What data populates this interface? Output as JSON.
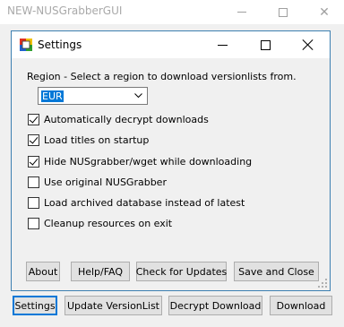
{
  "main_window": {
    "title": "NEW-NUSGrabberGUI",
    "buttons": {
      "settings": "Settings",
      "update_versionlist": "Update VersionList",
      "decrypt_download": "Decrypt Download",
      "download": "Download"
    }
  },
  "settings_dialog": {
    "title": "Settings",
    "region_label": "Region - Select a region to download versionlists from.",
    "region_selected": "EUR",
    "options": [
      {
        "label": "Automatically decrypt downloads",
        "checked": true
      },
      {
        "label": "Load titles on startup",
        "checked": true
      },
      {
        "label": "Hide NUSgrabber/wget while downloading",
        "checked": true
      },
      {
        "label": "Use original NUSGrabber",
        "checked": false
      },
      {
        "label": "Load archived database instead of latest",
        "checked": false
      },
      {
        "label": "Cleanup resources on exit",
        "checked": false
      }
    ],
    "buttons": {
      "about": "About",
      "help_faq": "Help/FAQ",
      "check_updates": "Check for Updates",
      "save_close": "Save and Close"
    }
  }
}
